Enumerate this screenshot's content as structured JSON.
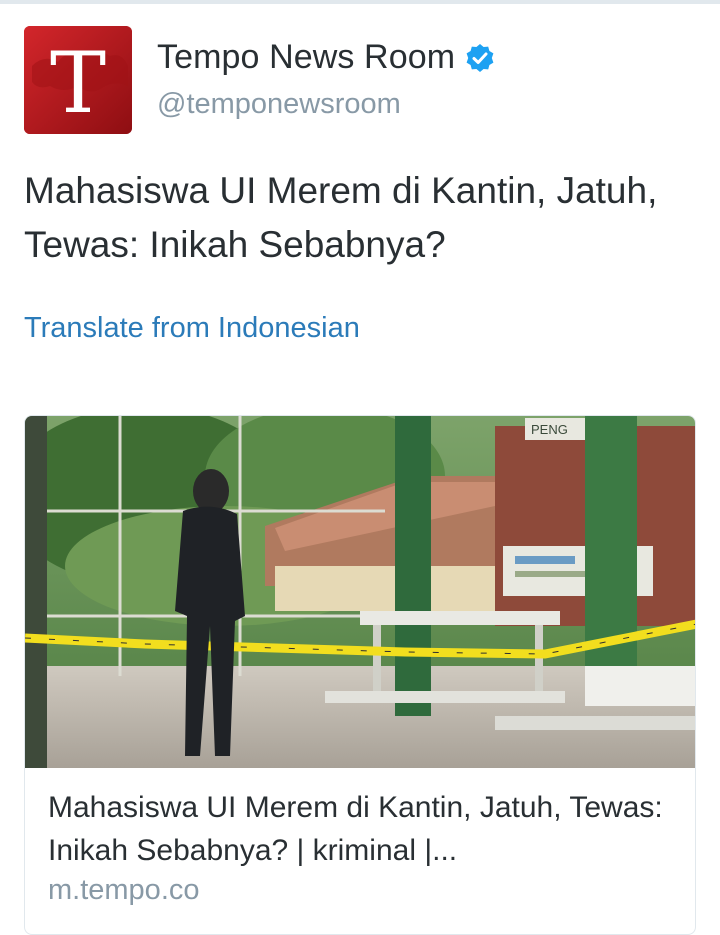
{
  "account": {
    "display_name": "Tempo News Room",
    "handle": "@temponewsroom",
    "avatar_letter": "T",
    "verified": true
  },
  "tweet": {
    "text": "Mahasiswa UI Merem di Kantin, Jatuh, Tewas: Inikah Sebabnya?",
    "translate_label": "Translate from Indonesian"
  },
  "card": {
    "title": "Mahasiswa UI Merem di Kantin, Jatuh, Tewas: Inikah Sebabnya? | kriminal |...",
    "domain": "m.tempo.co",
    "sign_text": "PENG"
  },
  "colors": {
    "text_primary": "#292f33",
    "text_secondary": "#8899a6",
    "link": "#2b7bb9",
    "verified": "#1da1f2",
    "avatar_red": "#b8151b"
  },
  "icons": {
    "verified": "verified-badge-icon"
  }
}
